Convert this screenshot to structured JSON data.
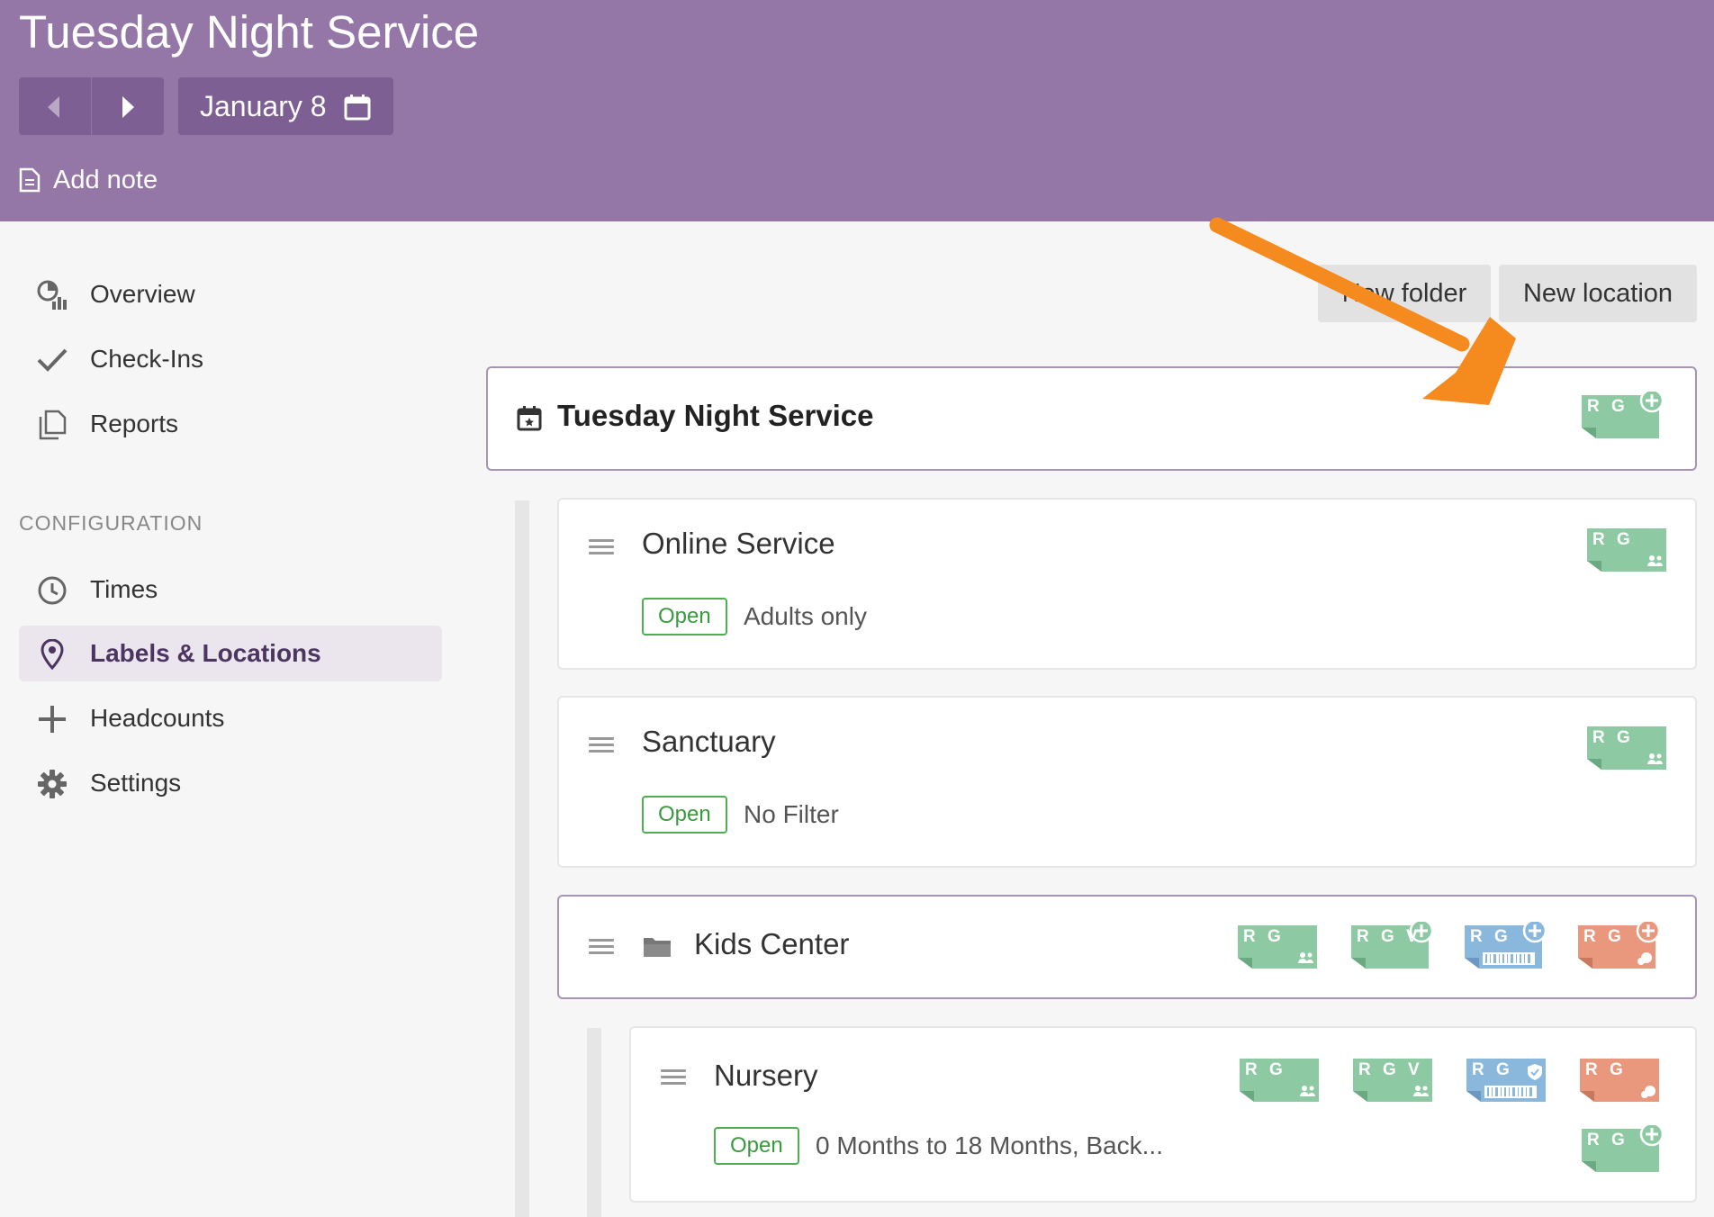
{
  "header": {
    "title": "Tuesday Night Service",
    "date_label": "January 8",
    "add_note_label": "Add note"
  },
  "sidebar": {
    "items": [
      {
        "label": "Overview",
        "icon": "chart-icon"
      },
      {
        "label": "Check-Ins",
        "icon": "check-icon"
      },
      {
        "label": "Reports",
        "icon": "reports-icon"
      }
    ],
    "config_heading": "CONFIGURATION",
    "config_items": [
      {
        "label": "Times",
        "icon": "clock-icon"
      },
      {
        "label": "Labels & Locations",
        "icon": "location-pin-icon",
        "active": true
      },
      {
        "label": "Headcounts",
        "icon": "plus-icon"
      },
      {
        "label": "Settings",
        "icon": "gear-icon"
      }
    ]
  },
  "toolbar": {
    "new_folder_label": "New folder",
    "new_location_label": "New location"
  },
  "event": {
    "title": "Tuesday Night Service",
    "label_letters": "R G"
  },
  "locations": [
    {
      "title": "Online Service",
      "status": "Open",
      "filter": "Adults only",
      "label_letters": "R G"
    },
    {
      "title": "Sanctuary",
      "status": "Open",
      "filter": "No Filter",
      "label_letters": "R G"
    }
  ],
  "folder": {
    "title": "Kids Center",
    "labels": [
      "R G",
      "R G V",
      "R G",
      "R G"
    ]
  },
  "nursery": {
    "title": "Nursery",
    "status": "Open",
    "filter": "0 Months to 18 Months, Back...",
    "labels": [
      "R G",
      "R G V",
      "R G",
      "R G",
      "R G"
    ]
  },
  "colors": {
    "header_bg": "#9477a6",
    "label_green": "#8dcaa3",
    "label_blue": "#8ab8dd",
    "label_orange": "#e9977d",
    "arrow": "#f58a1f",
    "status_green": "#4caf50"
  }
}
